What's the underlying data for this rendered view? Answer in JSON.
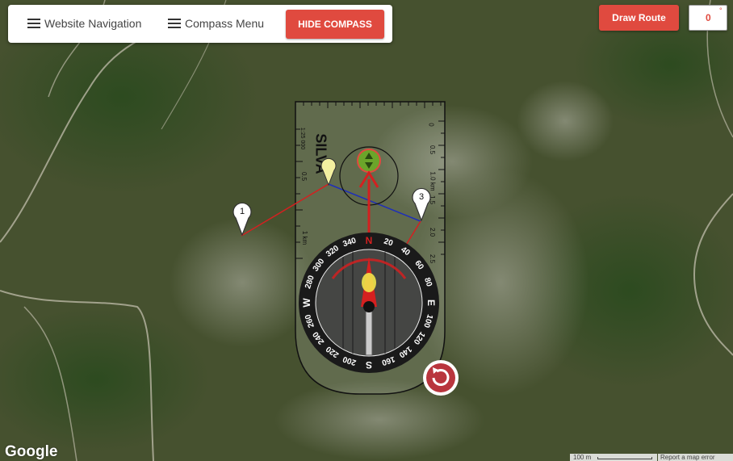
{
  "toolbar": {
    "website_nav_label": "Website Navigation",
    "compass_menu_label": "Compass Menu",
    "hide_compass_label": "HIDE COMPASS"
  },
  "route": {
    "draw_route_label": "Draw Route",
    "heading_value": "0",
    "degree_symbol": "°"
  },
  "markers": [
    {
      "label": "1"
    },
    {
      "label": "3"
    }
  ],
  "baseplate": {
    "brand": "SILVA",
    "scale_label": "1:25 000",
    "left_ticks": [
      "0.5",
      "1 km"
    ],
    "right_ticks": [
      "0",
      "0.5",
      "1.0 km",
      "1.5",
      "2.0",
      "2.5"
    ]
  },
  "bezel": {
    "labels": [
      "N",
      "20",
      "40",
      "60",
      "80",
      "E",
      "100",
      "120",
      "140",
      "160",
      "S",
      "200",
      "220",
      "240",
      "260",
      "W",
      "280",
      "300",
      "320",
      "340"
    ]
  },
  "map_footer": {
    "google": "Google",
    "scale": "100 m",
    "report": "Report a map error"
  },
  "colors": {
    "accent": "#e04a3f",
    "compass_red": "#d42020",
    "bearing_line": "#1f2fb8"
  },
  "icons": {
    "menu": "hamburger-icon",
    "rotate": "rotate-icon"
  }
}
